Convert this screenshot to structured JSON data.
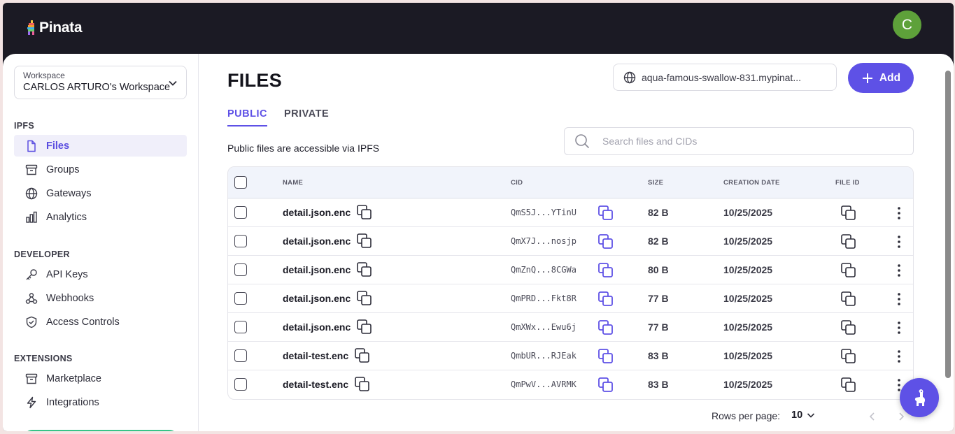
{
  "brand": {
    "name": "Pinata"
  },
  "user": {
    "initial": "C",
    "color": "#5ea13a"
  },
  "workspace": {
    "label": "Workspace",
    "name": "CARLOS ARTURO's Workspace"
  },
  "sidebar": {
    "sections": [
      {
        "title": "IPFS",
        "items": [
          {
            "label": "Files",
            "icon": "file-icon",
            "active": true
          },
          {
            "label": "Groups",
            "icon": "archive-icon"
          },
          {
            "label": "Gateways",
            "icon": "globe-icon"
          },
          {
            "label": "Analytics",
            "icon": "bar-chart-icon"
          }
        ]
      },
      {
        "title": "DEVELOPER",
        "items": [
          {
            "label": "API Keys",
            "icon": "key-icon"
          },
          {
            "label": "Webhooks",
            "icon": "webhook-icon"
          },
          {
            "label": "Access Controls",
            "icon": "shield-icon"
          }
        ]
      },
      {
        "title": "EXTENSIONS",
        "items": [
          {
            "label": "Marketplace",
            "icon": "archive-icon"
          },
          {
            "label": "Integrations",
            "icon": "bolt-icon"
          }
        ]
      }
    ]
  },
  "main": {
    "title": "FILES",
    "gateway": "aqua-famous-swallow-831.mypinat...",
    "add_label": "Add",
    "tabs": [
      {
        "label": "PUBLIC",
        "active": true
      },
      {
        "label": "PRIVATE"
      }
    ],
    "subtitle": "Public files are accessible via IPFS",
    "search_placeholder": "Search files and CIDs",
    "columns": {
      "name": "NAME",
      "cid": "CID",
      "size": "SIZE",
      "date": "CREATION DATE",
      "file_id": "FILE ID"
    },
    "rows": [
      {
        "name": "detail.json.enc",
        "cid": "QmS5J...YTinU",
        "size": "82 B",
        "date": "10/25/2025"
      },
      {
        "name": "detail.json.enc",
        "cid": "QmX7J...nosjp",
        "size": "82 B",
        "date": "10/25/2025"
      },
      {
        "name": "detail.json.enc",
        "cid": "QmZnQ...8CGWa",
        "size": "80 B",
        "date": "10/25/2025"
      },
      {
        "name": "detail.json.enc",
        "cid": "QmPRD...Fkt8R",
        "size": "77 B",
        "date": "10/25/2025"
      },
      {
        "name": "detail.json.enc",
        "cid": "QmXWx...Ewu6j",
        "size": "77 B",
        "date": "10/25/2025"
      },
      {
        "name": "detail-test.enc",
        "cid": "QmbUR...RJEak",
        "size": "83 B",
        "date": "10/25/2025"
      },
      {
        "name": "detail-test.enc",
        "cid": "QmPwV...AVRMK",
        "size": "83 B",
        "date": "10/25/2025"
      }
    ],
    "rows_per_page_label": "Rows per page:",
    "rows_per_page": "10"
  },
  "colors": {
    "accent": "#5e51e6",
    "topbar": "#1b1a24"
  }
}
